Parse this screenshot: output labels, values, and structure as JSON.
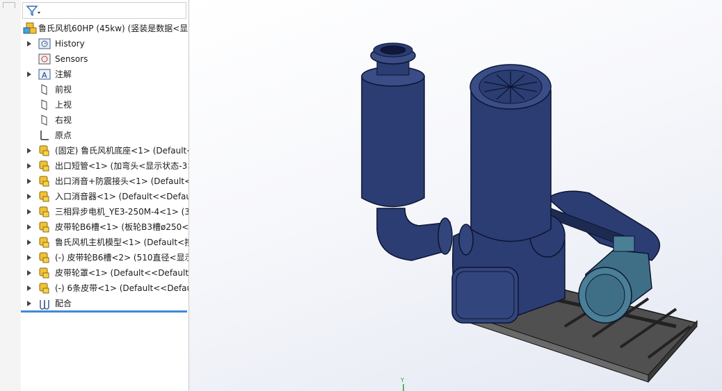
{
  "feature_tree": {
    "root_label": "鲁氏风机60HP (45kw) (竖装是数据<显",
    "items": [
      {
        "label": "History",
        "icon": "history-icon",
        "expandable": true
      },
      {
        "label": "Sensors",
        "icon": "sensor-icon",
        "expandable": false
      },
      {
        "label": "注解",
        "icon": "annotation-icon",
        "expandable": true
      },
      {
        "label": "前视",
        "icon": "plane-icon",
        "expandable": false
      },
      {
        "label": "上视",
        "icon": "plane-icon",
        "expandable": false
      },
      {
        "label": "右视",
        "icon": "plane-icon",
        "expandable": false
      },
      {
        "label": "原点",
        "icon": "origin-icon",
        "expandable": false
      },
      {
        "label": "(固定) 鲁氏风机底座<1> (Default<",
        "icon": "part-icon",
        "expandable": true
      },
      {
        "label": "出口短管<1> (加弯头<显示状态-3>",
        "icon": "part-icon",
        "expandable": true
      },
      {
        "label": "出口消音+防震接头<1> (Default<",
        "icon": "part-icon",
        "expandable": true
      },
      {
        "label": "入口消音器<1> (Default<<Defaul",
        "icon": "part-icon",
        "expandable": true
      },
      {
        "label": "三相异步电机_YE3-250M-4<1> (3",
        "icon": "part-icon",
        "expandable": true
      },
      {
        "label": "皮带轮B6槽<1> (板轮B3槽ø250<显",
        "icon": "part-icon",
        "expandable": true
      },
      {
        "label": "鲁氏风机主机模型<1> (Default<按",
        "icon": "part-icon",
        "expandable": true
      },
      {
        "label": "(-) 皮带轮B6槽<2> (510直径<显示",
        "icon": "part-icon",
        "expandable": true
      },
      {
        "label": "皮带轮罩<1> (Default<<Default>",
        "icon": "part-icon",
        "expandable": true
      },
      {
        "label": "(-) 6条皮带<1> (Default<<Defaul",
        "icon": "part-icon",
        "expandable": true
      },
      {
        "label": "配合",
        "icon": "mate-icon",
        "expandable": true
      }
    ]
  },
  "triad_label": "Y",
  "colors": {
    "accent": "#3e8ad6",
    "model_body": "#2b3d72",
    "motor": "#3f6f86",
    "base_frame": "#4a4a4a"
  }
}
